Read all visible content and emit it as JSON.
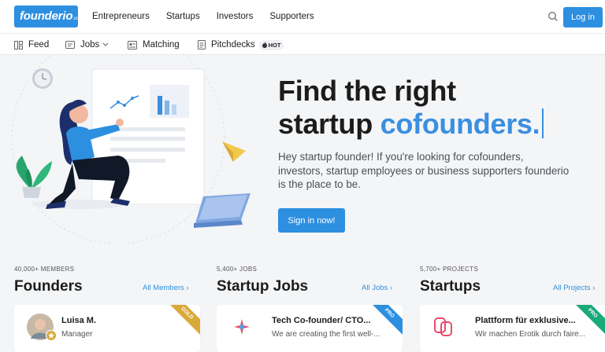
{
  "header": {
    "logo": "founderio",
    "logo_suffix": ".com",
    "nav": [
      "Entrepreneurs",
      "Startups",
      "Investors",
      "Supporters"
    ],
    "login_label": "Log in"
  },
  "subnav": {
    "feed": "Feed",
    "jobs": "Jobs",
    "matching": "Matching",
    "pitchdecks": "Pitchdecks",
    "hot_badge": "HOT"
  },
  "hero": {
    "title_line1": "Find the right",
    "title_line2_plain": "startup ",
    "title_line2_accent": "cofounders.",
    "text": "Hey startup founder! If you're looking for cofounders, investors, startup employees or business supporters founderio is the place to be.",
    "cta": "Sign in now!"
  },
  "sections": {
    "founders": {
      "kicker": "40,000+ MEMBERS",
      "title": "Founders",
      "link": "All Members"
    },
    "jobs": {
      "kicker": "5,400+ JOBS",
      "title": "Startup Jobs",
      "link": "All Jobs"
    },
    "startups": {
      "kicker": "5,700+ PROJECTS",
      "title": "Startups",
      "link": "All Projects"
    }
  },
  "cards": {
    "founder": {
      "name": "Luisa M.",
      "role": "Manager",
      "ribbon": "GOLD"
    },
    "job": {
      "title": "Tech Co-founder/ CTO...",
      "sub": "We are creating the first well-...",
      "ribbon": "PRO"
    },
    "startup": {
      "title": "Plattform für exklusive...",
      "sub": "Wir machen Erotik durch faire...",
      "ribbon": "PRO"
    }
  },
  "colors": {
    "brand": "#2d8fe0",
    "gold": "#d9a93a",
    "pro_blue": "#2d8fe0",
    "pro_green": "#1aa97a"
  }
}
